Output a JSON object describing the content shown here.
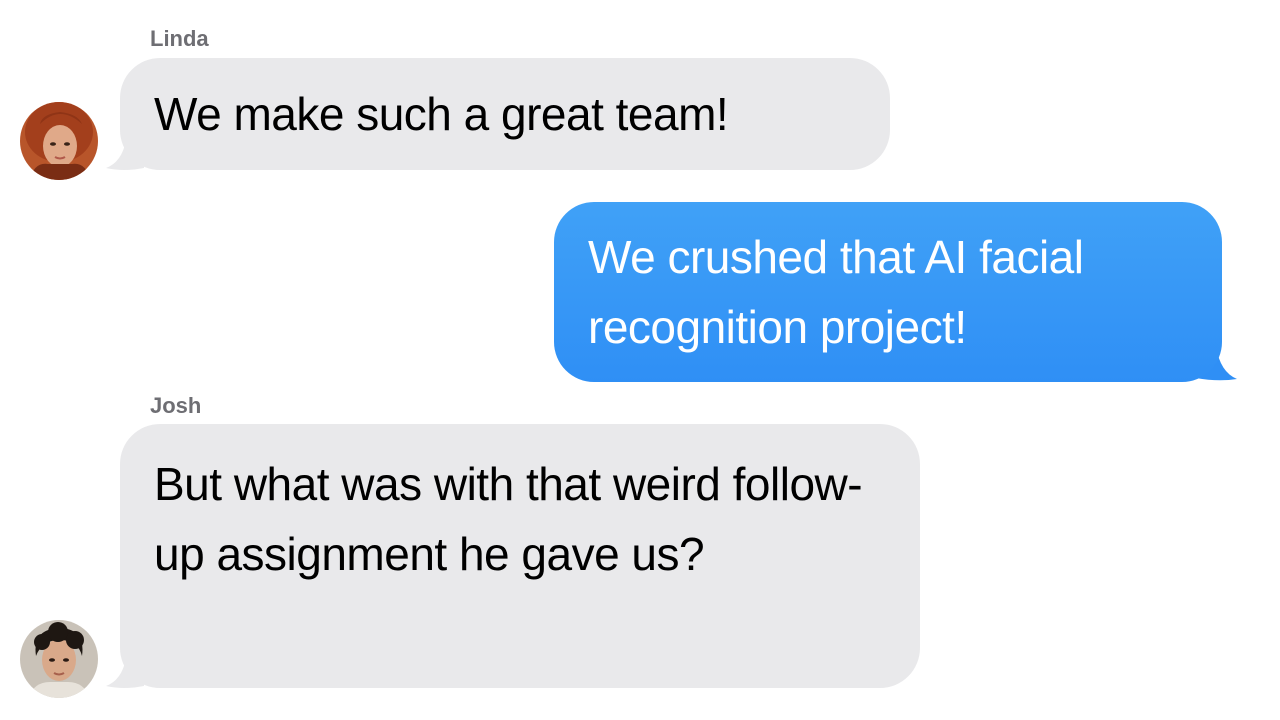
{
  "conversation": {
    "messages": [
      {
        "sender": "Linda",
        "direction": "incoming",
        "avatar": "linda-avatar",
        "text": "We make such a great team!"
      },
      {
        "sender": "",
        "direction": "outgoing",
        "text": "We crushed that AI facial recognition project!"
      },
      {
        "sender": "Josh",
        "direction": "incoming",
        "avatar": "josh-avatar",
        "text": "But what was with that weird follow-up assignment he gave us?"
      }
    ]
  },
  "colors": {
    "incoming_bubble": "#e9e9eb",
    "outgoing_bubble": "#3a97f6",
    "sender_name": "#6e6e73"
  }
}
